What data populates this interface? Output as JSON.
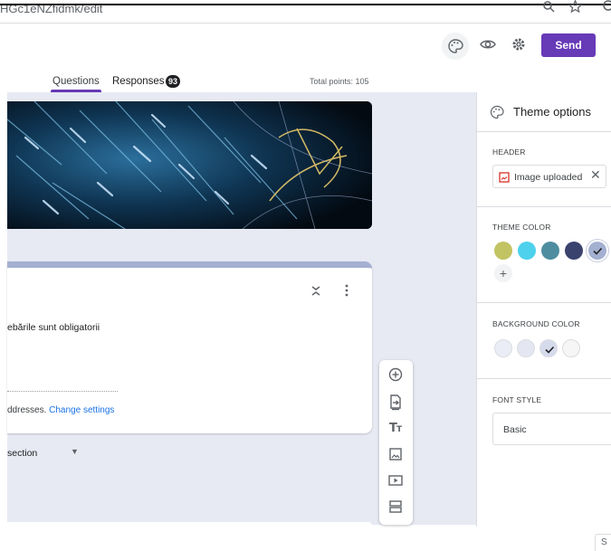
{
  "browser": {
    "url_fragment": "HGc1eNZfidmk/edit",
    "icons": [
      "search-icon",
      "star-icon",
      "profile-icon"
    ]
  },
  "header": {
    "send_label": "Send",
    "icons": [
      "palette-icon",
      "preview-eye-icon",
      "settings-gear-icon"
    ]
  },
  "tabs": {
    "questions": "Questions",
    "responses": "Responses",
    "responses_count": "93",
    "total_points": "Total points: 105"
  },
  "form": {
    "required_note": "ebările sunt obligatorii",
    "emails_note": "ddresses.",
    "change_settings": "Change settings",
    "section_label": "section"
  },
  "toolbar": {
    "items": [
      "add-question-icon",
      "import-questions-icon",
      "add-title-icon",
      "add-image-icon",
      "add-video-icon",
      "add-section-icon"
    ]
  },
  "theme_panel": {
    "title": "Theme options",
    "header_label": "HEADER",
    "image_chip": "Image uploaded",
    "theme_color_label": "THEME COLOR",
    "theme_colors": [
      "#c2c363",
      "#4dd1ed",
      "#4e8da0",
      "#3a436e",
      "#a4b0d1"
    ],
    "theme_selected_index": 4,
    "background_color_label": "BACKGROUND COLOR",
    "background_colors": [
      "#ebedf6",
      "#e4e7f2",
      "#d6dbec",
      "#f6f6f6"
    ],
    "background_selected_index": 2,
    "font_style_label": "FONT STYLE",
    "font_style_value": "Basic"
  },
  "footer": {
    "corner_letter": "S"
  },
  "colors": {
    "accent": "#673ab7",
    "canvas": "#e7e9f3",
    "card_top": "#a4b0d1",
    "link": "#1a73e8"
  }
}
